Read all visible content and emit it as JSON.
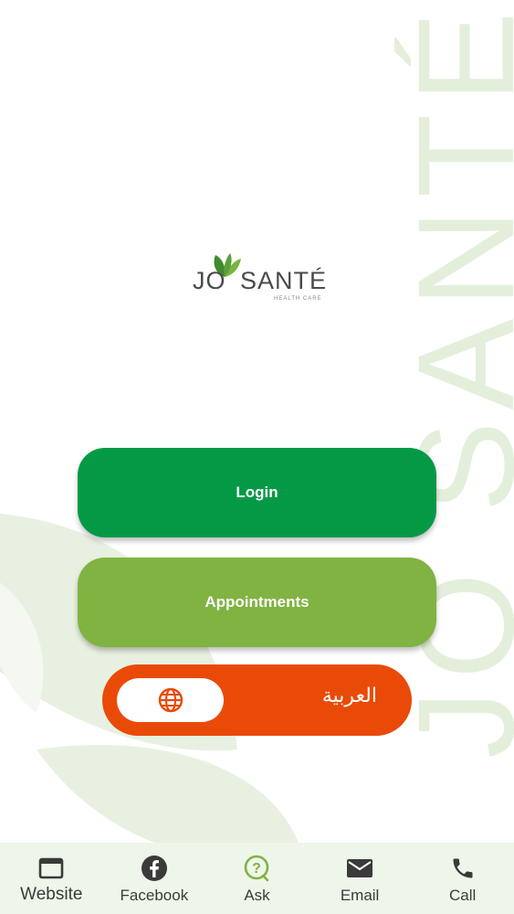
{
  "colors": {
    "login": "#049a45",
    "appointments": "#80b342",
    "language": "#ea4a07",
    "watermark": "#e3efdb",
    "tabbar": "#eef6ea"
  },
  "logo": {
    "brand_prefix": "JO",
    "brand_main": "SANTÉ",
    "tagline": "HEALTH CARE"
  },
  "watermark_text": "JO SANTÉ",
  "buttons": {
    "login": "Login",
    "appointments": "Appointments"
  },
  "language_toggle": {
    "icon": "globe-icon",
    "label": "العربية"
  },
  "tabs": [
    {
      "label": "Website",
      "icon": "browser-window-icon"
    },
    {
      "label": "Facebook",
      "icon": "facebook-icon"
    },
    {
      "label": "Ask",
      "icon": "question-chat-icon"
    },
    {
      "label": "Email",
      "icon": "envelope-icon"
    },
    {
      "label": "Call",
      "icon": "phone-icon"
    }
  ]
}
